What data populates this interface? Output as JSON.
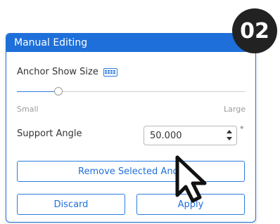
{
  "step_badge": "02",
  "panel": {
    "title": "Manual Editing",
    "anchor_show_size_label": "Anchor Show Size",
    "keyboard_icon": "keyboard-icon",
    "slider": {
      "min_label": "Small",
      "max_label": "Large",
      "value_fraction": 0.18
    },
    "support_angle_label": "Support Angle",
    "support_angle_value": "50.000",
    "degree_symbol": "°",
    "remove_button": "Remove Selected Anch",
    "discard_button": "Discard",
    "apply_button": "Apply"
  },
  "colors": {
    "accent": "#1e6fd9",
    "badge": "#222222"
  },
  "cursor_icon": "pointer-arrow-icon"
}
